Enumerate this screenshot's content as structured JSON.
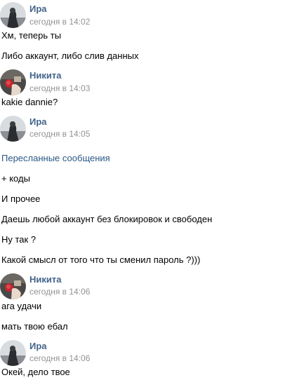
{
  "colors": {
    "name": "#42648b",
    "time": "#939393",
    "message_text": "#000000",
    "forwarded_label": "#2a5885",
    "background": "#ffffff"
  },
  "messages": [
    {
      "author": "Ира",
      "time": "сегодня в 14:02",
      "avatar_icon": "ira-avatar-icon",
      "lines": [
        "Хм, теперь ты",
        "Либо аккаунт, либо слив данных"
      ]
    },
    {
      "author": "Никита",
      "time": "сегодня в 14:03",
      "avatar_icon": "nikita-avatar-icon",
      "lines": [
        "kakie dannie?"
      ]
    },
    {
      "author": "Ира",
      "time": "сегодня в 14:05",
      "avatar_icon": "ira-avatar-icon",
      "forwarded_label": "Пересланные сообщения",
      "lines": [
        "+ коды",
        "И прочее",
        "Даешь любой аккаунт без блокировок и свободен",
        "Ну так ?",
        "Какой смысл от того что ты сменил пароль ?)))"
      ]
    },
    {
      "author": "Никита",
      "time": "сегодня в 14:06",
      "avatar_icon": "nikita-avatar-icon",
      "lines": [
        "ага удачи",
        "мать твою ебал"
      ]
    },
    {
      "author": "Ира",
      "time": "сегодня в 14:06",
      "avatar_icon": "ira-avatar-icon",
      "lines": [
        "Окей, дело твое"
      ]
    }
  ]
}
